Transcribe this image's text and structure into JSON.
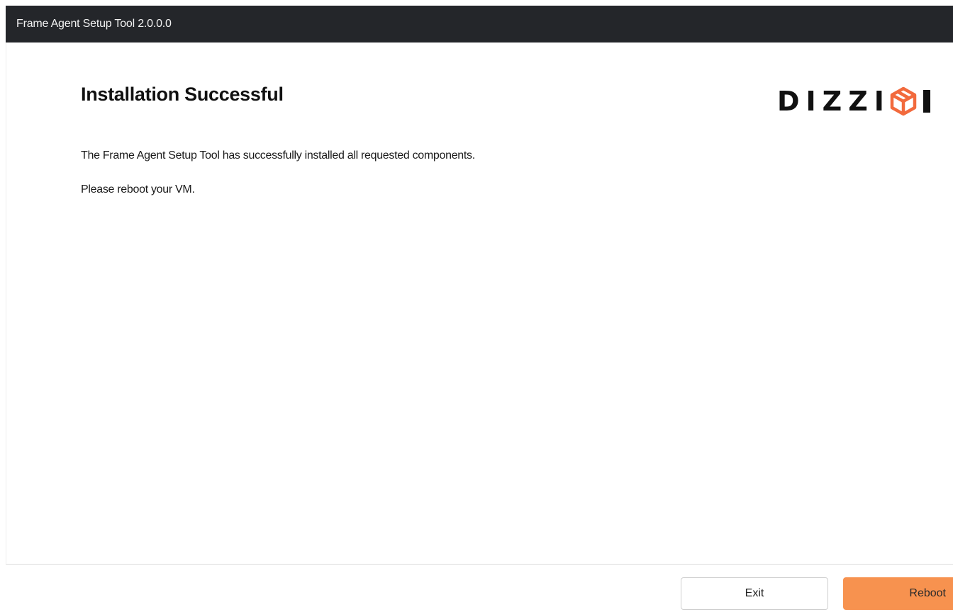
{
  "window": {
    "title": "Frame Agent Setup Tool 2.0.0.0"
  },
  "main": {
    "heading": "Installation Successful",
    "messages": [
      "The Frame Agent Setup Tool has successfully installed all requested components.",
      "Please reboot your VM."
    ]
  },
  "logo": {
    "text": "DIZZI",
    "icon": "cube-icon",
    "accent_color": "#f26a3d"
  },
  "footer": {
    "exit_label": "Exit",
    "reboot_label": "Reboot",
    "reboot_color": "#f7924f"
  }
}
